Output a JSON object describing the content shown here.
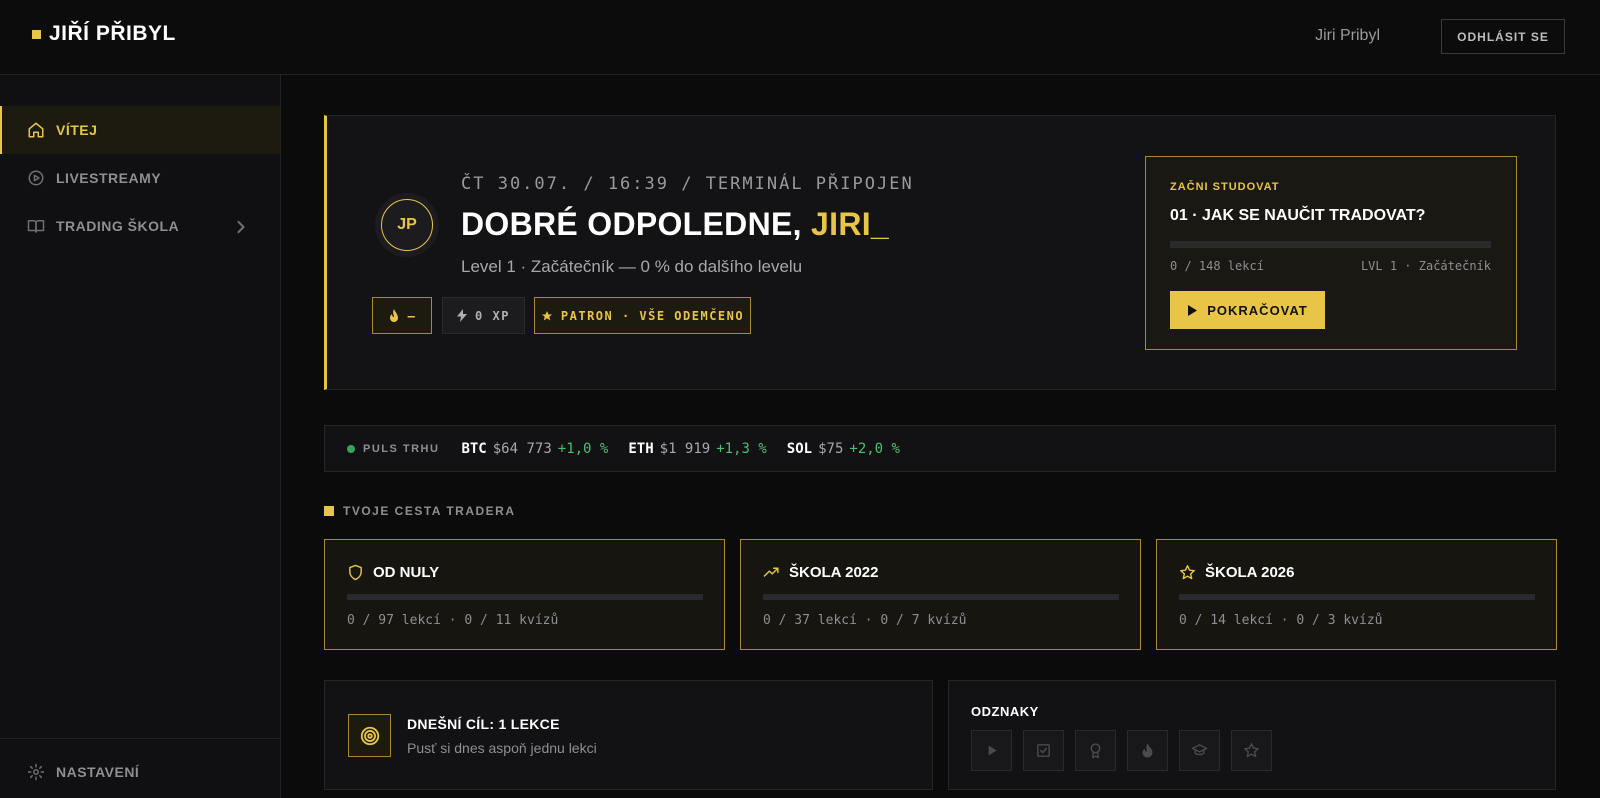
{
  "header": {
    "logo_text": "JIŘÍ PŘIBYL",
    "user_name": "Jiri Pribyl",
    "logout_label": "ODHLÁSIT SE"
  },
  "sidebar": {
    "items": [
      {
        "label": "VÍTEJ",
        "icon": "home-icon",
        "active": true
      },
      {
        "label": "LIVESTREAMY",
        "icon": "play-circle-icon",
        "active": false
      },
      {
        "label": "TRADING ŠKOLA",
        "icon": "book-icon",
        "active": false
      }
    ],
    "settings_label": "NASTAVENÍ"
  },
  "hero": {
    "avatar_initials": "JP",
    "datetime": "ČT 30.07. / 16:39 / TERMINÁL PŘIPOJEN",
    "greeting_prefix": "DOBRÉ ODPOLEDNE, ",
    "greeting_name": "JIRI_",
    "level_line": "Level 1 · Začátečník — 0 % do dalšího levelu",
    "streak_label": "—",
    "xp_label": "0 XP",
    "patron_label": "PATRON · VŠE ODEMČENO"
  },
  "study": {
    "label": "ZAČNI STUDOVAT",
    "title": "01 · JAK SE NAUČIT TRADOVAT?",
    "progress": 0,
    "count": "0 / 148 lekcí",
    "level": "LVL 1 · Začátečník",
    "button_label": "POKRAČOVAT"
  },
  "market": {
    "label": "PULS TRHU",
    "tickers": [
      {
        "symbol": "BTC",
        "price": "$64 773",
        "change": "+1,0 %"
      },
      {
        "symbol": "ETH",
        "price": "$1 919",
        "change": "+1,3 %"
      },
      {
        "symbol": "SOL",
        "price": "$75",
        "change": "+2,0 %"
      }
    ]
  },
  "journey": {
    "title": "TVOJE CESTA TRADERA",
    "courses": [
      {
        "title": "OD NULY",
        "meta": "0 / 97 lekcí · 0 / 11 kvízů",
        "icon": "shield-icon",
        "progress": 0
      },
      {
        "title": "ŠKOLA 2022",
        "meta": "0 / 37 lekcí · 0 / 7 kvízů",
        "icon": "trending-up-icon",
        "progress": 0
      },
      {
        "title": "ŠKOLA 2026",
        "meta": "0 / 14 lekcí · 0 / 3 kvízů",
        "icon": "star-icon",
        "progress": 0
      }
    ]
  },
  "goal": {
    "title": "DNEŠNÍ CÍL: 1 LEKCE",
    "subtitle": "Pusť si dnes aspoň jednu lekci"
  },
  "badges": {
    "title": "ODZNAKY",
    "items": [
      "play-icon",
      "checkbox-icon",
      "award-icon",
      "flame-icon",
      "graduation-cap-icon",
      "star-icon"
    ]
  },
  "colors": {
    "accent": "#e8c547",
    "positive": "#4cbf6e",
    "background": "#0b0b0c"
  }
}
